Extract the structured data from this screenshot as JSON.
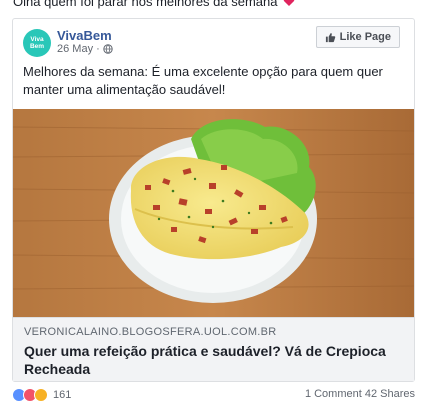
{
  "post": {
    "caption": "Olha quem foi parar nos melhores da semana",
    "page_name": "VivaBem",
    "avatar_text_line1": "Viva",
    "avatar_text_line2": "Bem",
    "date": "26 May",
    "separator": "·",
    "privacy_icon": "globe-icon",
    "like_page_label": "Like Page",
    "text": "Melhores da semana: É uma excelente opção para quem quer manter uma alimentação saudável!",
    "link": {
      "domain": "VERONICALAINO.BLOGOSFERA.UOL.COM.BR",
      "title": "Quer uma refeição prática e saudável? Vá de Crepioca Recheada"
    },
    "reactions": {
      "count": "161",
      "types": [
        "like",
        "love",
        "wow"
      ]
    },
    "engagement": "1 Comment  42 Shares"
  },
  "colors": {
    "avatar_bg": "#29c7b8",
    "page_name": "#365899",
    "link_bg": "#f2f3f5",
    "heart": "#e0245e"
  }
}
